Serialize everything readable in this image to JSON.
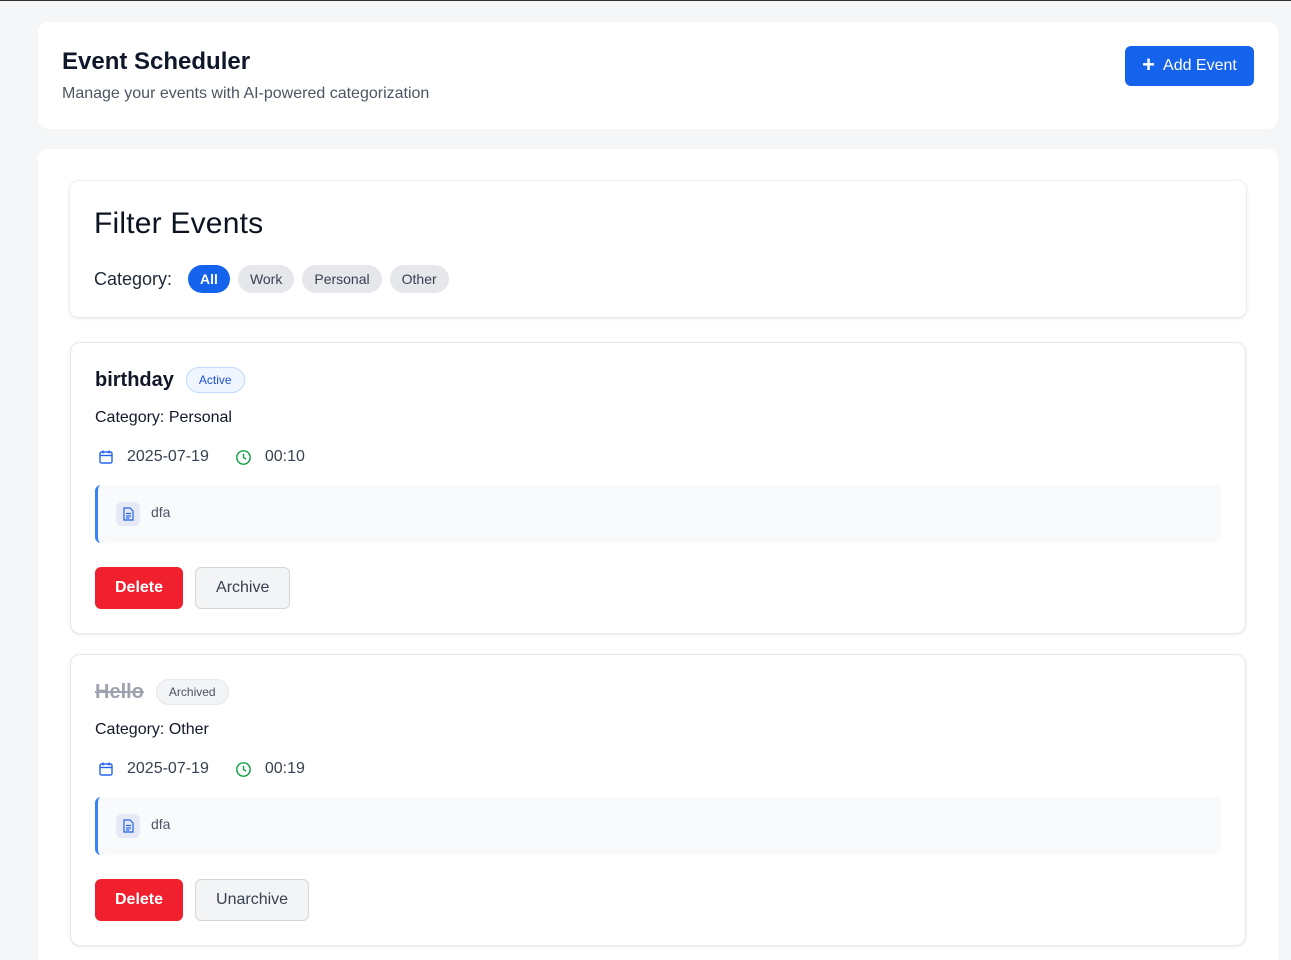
{
  "header": {
    "title": "Event Scheduler",
    "subtitle": "Manage your events with AI-powered categorization",
    "add_button_label": "Add Event"
  },
  "filter": {
    "title": "Filter Events",
    "label": "Category:",
    "chips": [
      "All",
      "Work",
      "Personal",
      "Other"
    ],
    "selected": "All"
  },
  "events": [
    {
      "title": "birthday",
      "status": "Active",
      "category_text": "Category: Personal",
      "date": "2025-07-19",
      "time": "00:10",
      "description": "dfa",
      "delete_label": "Delete",
      "secondary_label": "Archive"
    },
    {
      "title": "Hello",
      "status": "Archived",
      "category_text": "Category: Other",
      "date": "2025-07-19",
      "time": "00:19",
      "description": "dfa",
      "delete_label": "Delete",
      "secondary_label": "Unarchive"
    }
  ],
  "colors": {
    "primary": "#1563ec",
    "danger": "#f0202e",
    "calendar_icon": "#2563eb",
    "clock_icon": "#16a34a"
  }
}
